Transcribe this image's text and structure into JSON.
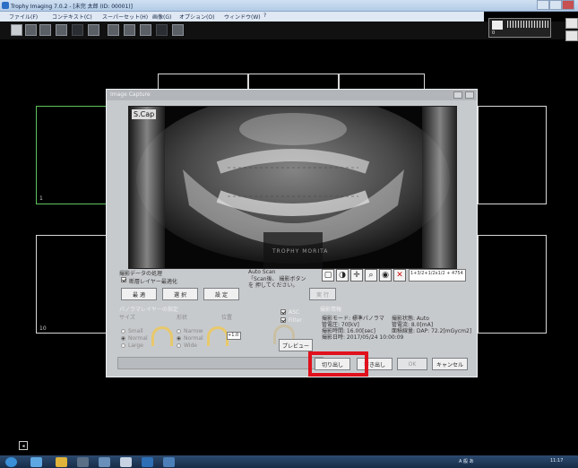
{
  "window": {
    "title": "Trophy Imaging 7.0.2 - [未完 太郎 (ID: 00001)]"
  },
  "menu": [
    "ファイル(F)",
    "コンテキスト(C)",
    "スーパーセット(H)",
    "画像(G)",
    "オプション(O)",
    "ウィンドウ(W)",
    "?"
  ],
  "device": {
    "label": "0"
  },
  "frames": {
    "left_top_num": "1",
    "left_bottom_num": "10"
  },
  "dialog": {
    "title": "Image Capture",
    "image_badge": "S.Cap",
    "image_brand": "TROPHY  MORITA",
    "section_capture": "撮影データの処理",
    "option_layer_opt": "断層レイヤー最適化",
    "btn_optimize": "最 適",
    "btn_select": "選 択",
    "btn_settings": "設 定",
    "auto_scan_label": "Auto Scan",
    "auto_scan_text": "「Scan後、 撮影ボタンを 押してください。",
    "btn_execute": "実 行",
    "ratio_text": "1+3/2+1/2x1/2 + 4754",
    "section_layer": "パノラマレイヤーの指定",
    "col_size": "サイズ",
    "col_shape": "形状",
    "col_position": "位置",
    "size_options": [
      "Small",
      "Normal",
      "Large"
    ],
    "shape_options": [
      "Narrow",
      "Normal",
      "Wide"
    ],
    "position_value": "+1.0",
    "chk_asc": "ASC",
    "chk_filter": "Filter",
    "btn_preview": "プレビュー",
    "section_info": "撮影情報",
    "info_lines": [
      "撮影モード: 標準パノラマ",
      "管電圧: 70[kV]",
      "撮影時間: 16.00[sec]",
      "撮影日時: 2017/05/24 10:00:09"
    ],
    "info_lines_right": [
      "撮影状態: Auto",
      "管電流: 8.0[mA]",
      "面積線量: DAP: 72.2[mGycm2]"
    ],
    "btn_cut": "切り出し",
    "btn_write": "書き出し",
    "btn_ok": "OK",
    "btn_cancel": "キャンセル"
  },
  "taskbar": {
    "ime": "A 般 あ",
    "time": "11:17"
  }
}
